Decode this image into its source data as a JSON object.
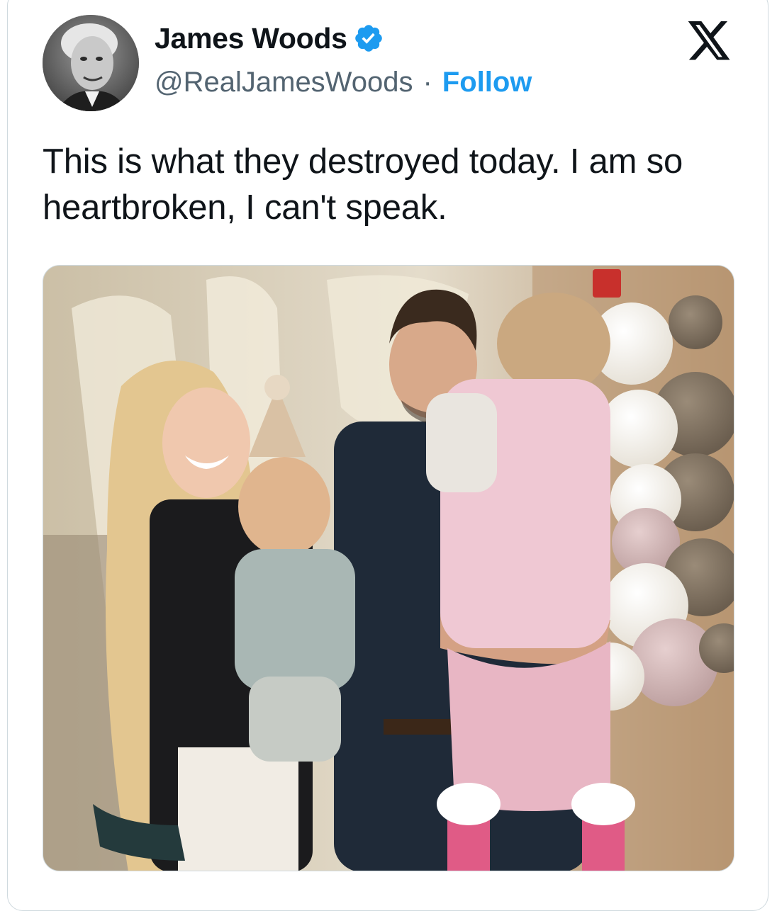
{
  "tweet": {
    "author": {
      "display_name": "James Woods",
      "handle": "@RealJamesWoods",
      "verified": true,
      "avatar_icon": "profile-photo"
    },
    "separator": "·",
    "follow_label": "Follow",
    "platform_icon": "x-logo-icon",
    "text": "This is what they destroyed today. I am so heartbroken, I can't speak.",
    "media": {
      "type": "photo"
    }
  },
  "colors": {
    "accent": "#1d9bf0",
    "text_primary": "#0f1419",
    "text_secondary": "#536471",
    "border": "#cfd9de"
  }
}
